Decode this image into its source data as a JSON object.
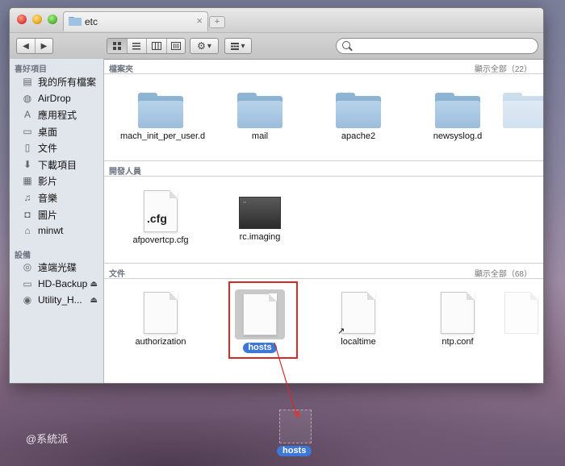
{
  "window": {
    "tab_title": "etc",
    "tab_close": "×",
    "tab_add": "+"
  },
  "toolbar": {
    "back": "◀",
    "forward": "▶",
    "action_caret": "▾",
    "arrange_caret": "▾"
  },
  "sidebar": {
    "favorites_header": "喜好項目",
    "favorites": [
      {
        "label": "我的所有檔案",
        "icon": "all-files-icon"
      },
      {
        "label": "AirDrop",
        "icon": "airdrop-icon"
      },
      {
        "label": "應用程式",
        "icon": "applications-icon"
      },
      {
        "label": "桌面",
        "icon": "desktop-icon"
      },
      {
        "label": "文件",
        "icon": "documents-icon"
      },
      {
        "label": "下載項目",
        "icon": "downloads-icon"
      },
      {
        "label": "影片",
        "icon": "movies-icon"
      },
      {
        "label": "音樂",
        "icon": "music-icon"
      },
      {
        "label": "圖片",
        "icon": "pictures-icon"
      },
      {
        "label": "minwt",
        "icon": "home-icon"
      }
    ],
    "devices_header": "設備",
    "devices": [
      {
        "label": "遠端光碟",
        "icon": "remote-disc-icon",
        "eject": ""
      },
      {
        "label": "HD-Backup",
        "icon": "drive-icon",
        "eject": "⏏"
      },
      {
        "label": "Utility_H...",
        "icon": "drive-icon",
        "eject": "⏏"
      }
    ]
  },
  "sections": {
    "folders": {
      "title": "檔案夾",
      "count": "顯示全部（22）",
      "items": [
        "mach_init_per_user.d",
        "mail",
        "apache2",
        "newsyslog.d"
      ]
    },
    "developer": {
      "title": "開發人員",
      "items": [
        "afpovertcp.cfg",
        "rc.imaging"
      ],
      "cfg_text": ".cfg"
    },
    "documents": {
      "title": "文件",
      "count": "顯示全部（68）",
      "items": [
        "authorization",
        "hosts",
        "localtime",
        "ntp.conf"
      ]
    }
  },
  "drag": {
    "label": "hosts"
  },
  "watermark": "@系統派",
  "colors": {
    "selection": "#3b78d8",
    "highlight_box": "#d32a2a",
    "folder": "#9bbddb"
  }
}
